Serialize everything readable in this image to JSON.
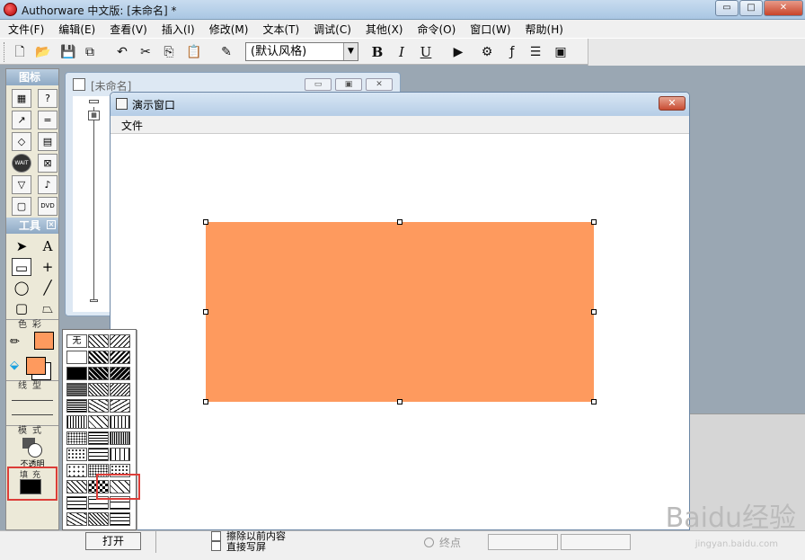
{
  "app": {
    "title": "Authorware 中文版: [未命名] *"
  },
  "window_buttons": {
    "minimize": "▭",
    "maximize": "□",
    "close": "✕"
  },
  "menu": [
    "文件(F)",
    "编辑(E)",
    "查看(V)",
    "插入(I)",
    "修改(M)",
    "文本(T)",
    "调试(C)",
    "其他(X)",
    "命令(O)",
    "窗口(W)",
    "帮助(H)"
  ],
  "toolbar": {
    "style_select": "(默认风格)",
    "bold": "B",
    "italic": "I",
    "underline": "U"
  },
  "design_window": {
    "title": "[未命名]"
  },
  "icon_palette": {
    "header": "图标",
    "icons": [
      "显示",
      "交互",
      "移动",
      "计算",
      "擦除",
      "群组",
      "WAIT",
      "数字电影",
      "决策",
      "声音",
      "框架",
      "DVD"
    ]
  },
  "tools_palette": {
    "header": "工具",
    "color_label": "色彩",
    "line_label": "线型",
    "mode_label": "模式",
    "mode_value": "不透明",
    "fill_label": "填充"
  },
  "patterns": {
    "none": "无"
  },
  "presentation_window": {
    "title": "演示窗口",
    "menu_file": "文件",
    "rect_color": "#fe9a5e"
  },
  "properties": {
    "open_button": "打开",
    "checkbox1": "擦除以前内容",
    "checkbox2": "直接写屏",
    "radio": "终点"
  },
  "watermark": {
    "text": "Baidu经验",
    "sub": "jingyan.baidu.com"
  },
  "colors": {
    "accent_red": "#dc3d38",
    "fill_orange": "#fe9a5e"
  }
}
